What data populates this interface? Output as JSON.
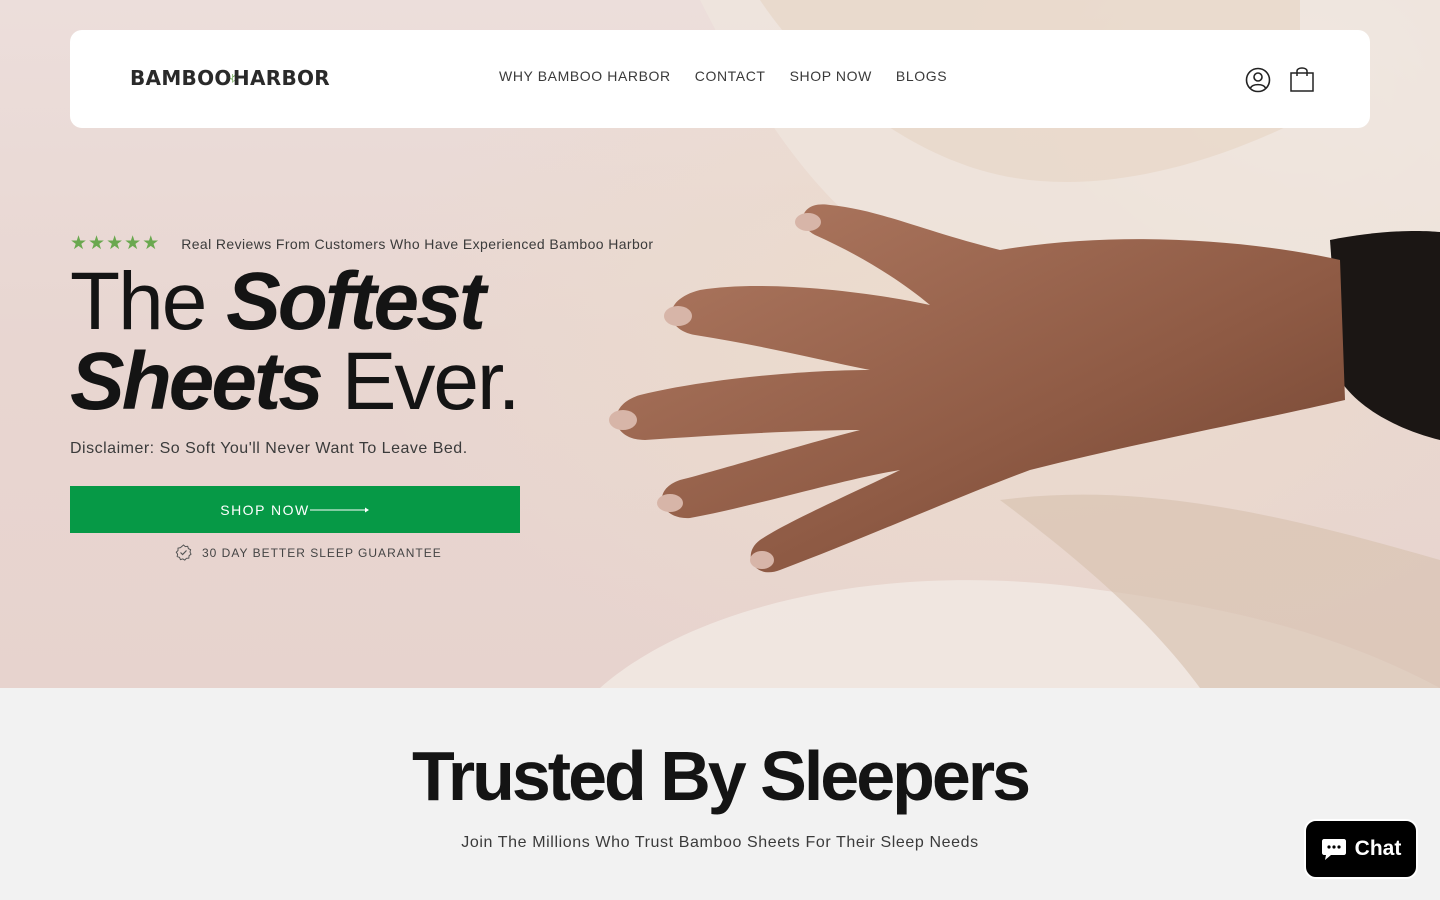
{
  "brand": {
    "logo_left": "BAMBOO",
    "logo_right": "HARBOR",
    "accent": "#069946",
    "star_color": "#6aa84f"
  },
  "nav": {
    "items": [
      {
        "label": "WHY BAMBOO HARBOR"
      },
      {
        "label": "CONTACT"
      },
      {
        "label": "SHOP NOW"
      },
      {
        "label": "BLOGS"
      }
    ]
  },
  "header_icons": [
    "account-icon",
    "cart-icon"
  ],
  "hero": {
    "rating_stars": 5,
    "reviews_text": "Real Reviews From Customers Who Have Experienced Bamboo Harbor",
    "headline": {
      "w1": "The",
      "w2": "Softest",
      "w3": "Sheets",
      "w4": "Ever."
    },
    "disclaimer": "Disclaimer: So Soft You'll Never Want To Leave Bed.",
    "cta_label": "SHOP NOW",
    "guarantee": "30 DAY BETTER SLEEP GUARANTEE"
  },
  "trusted": {
    "title": "Trusted By Sleepers",
    "subtitle": "Join The Millions Who Trust Bamboo Sheets For Their Sleep Needs"
  },
  "chat": {
    "label": "Chat"
  }
}
